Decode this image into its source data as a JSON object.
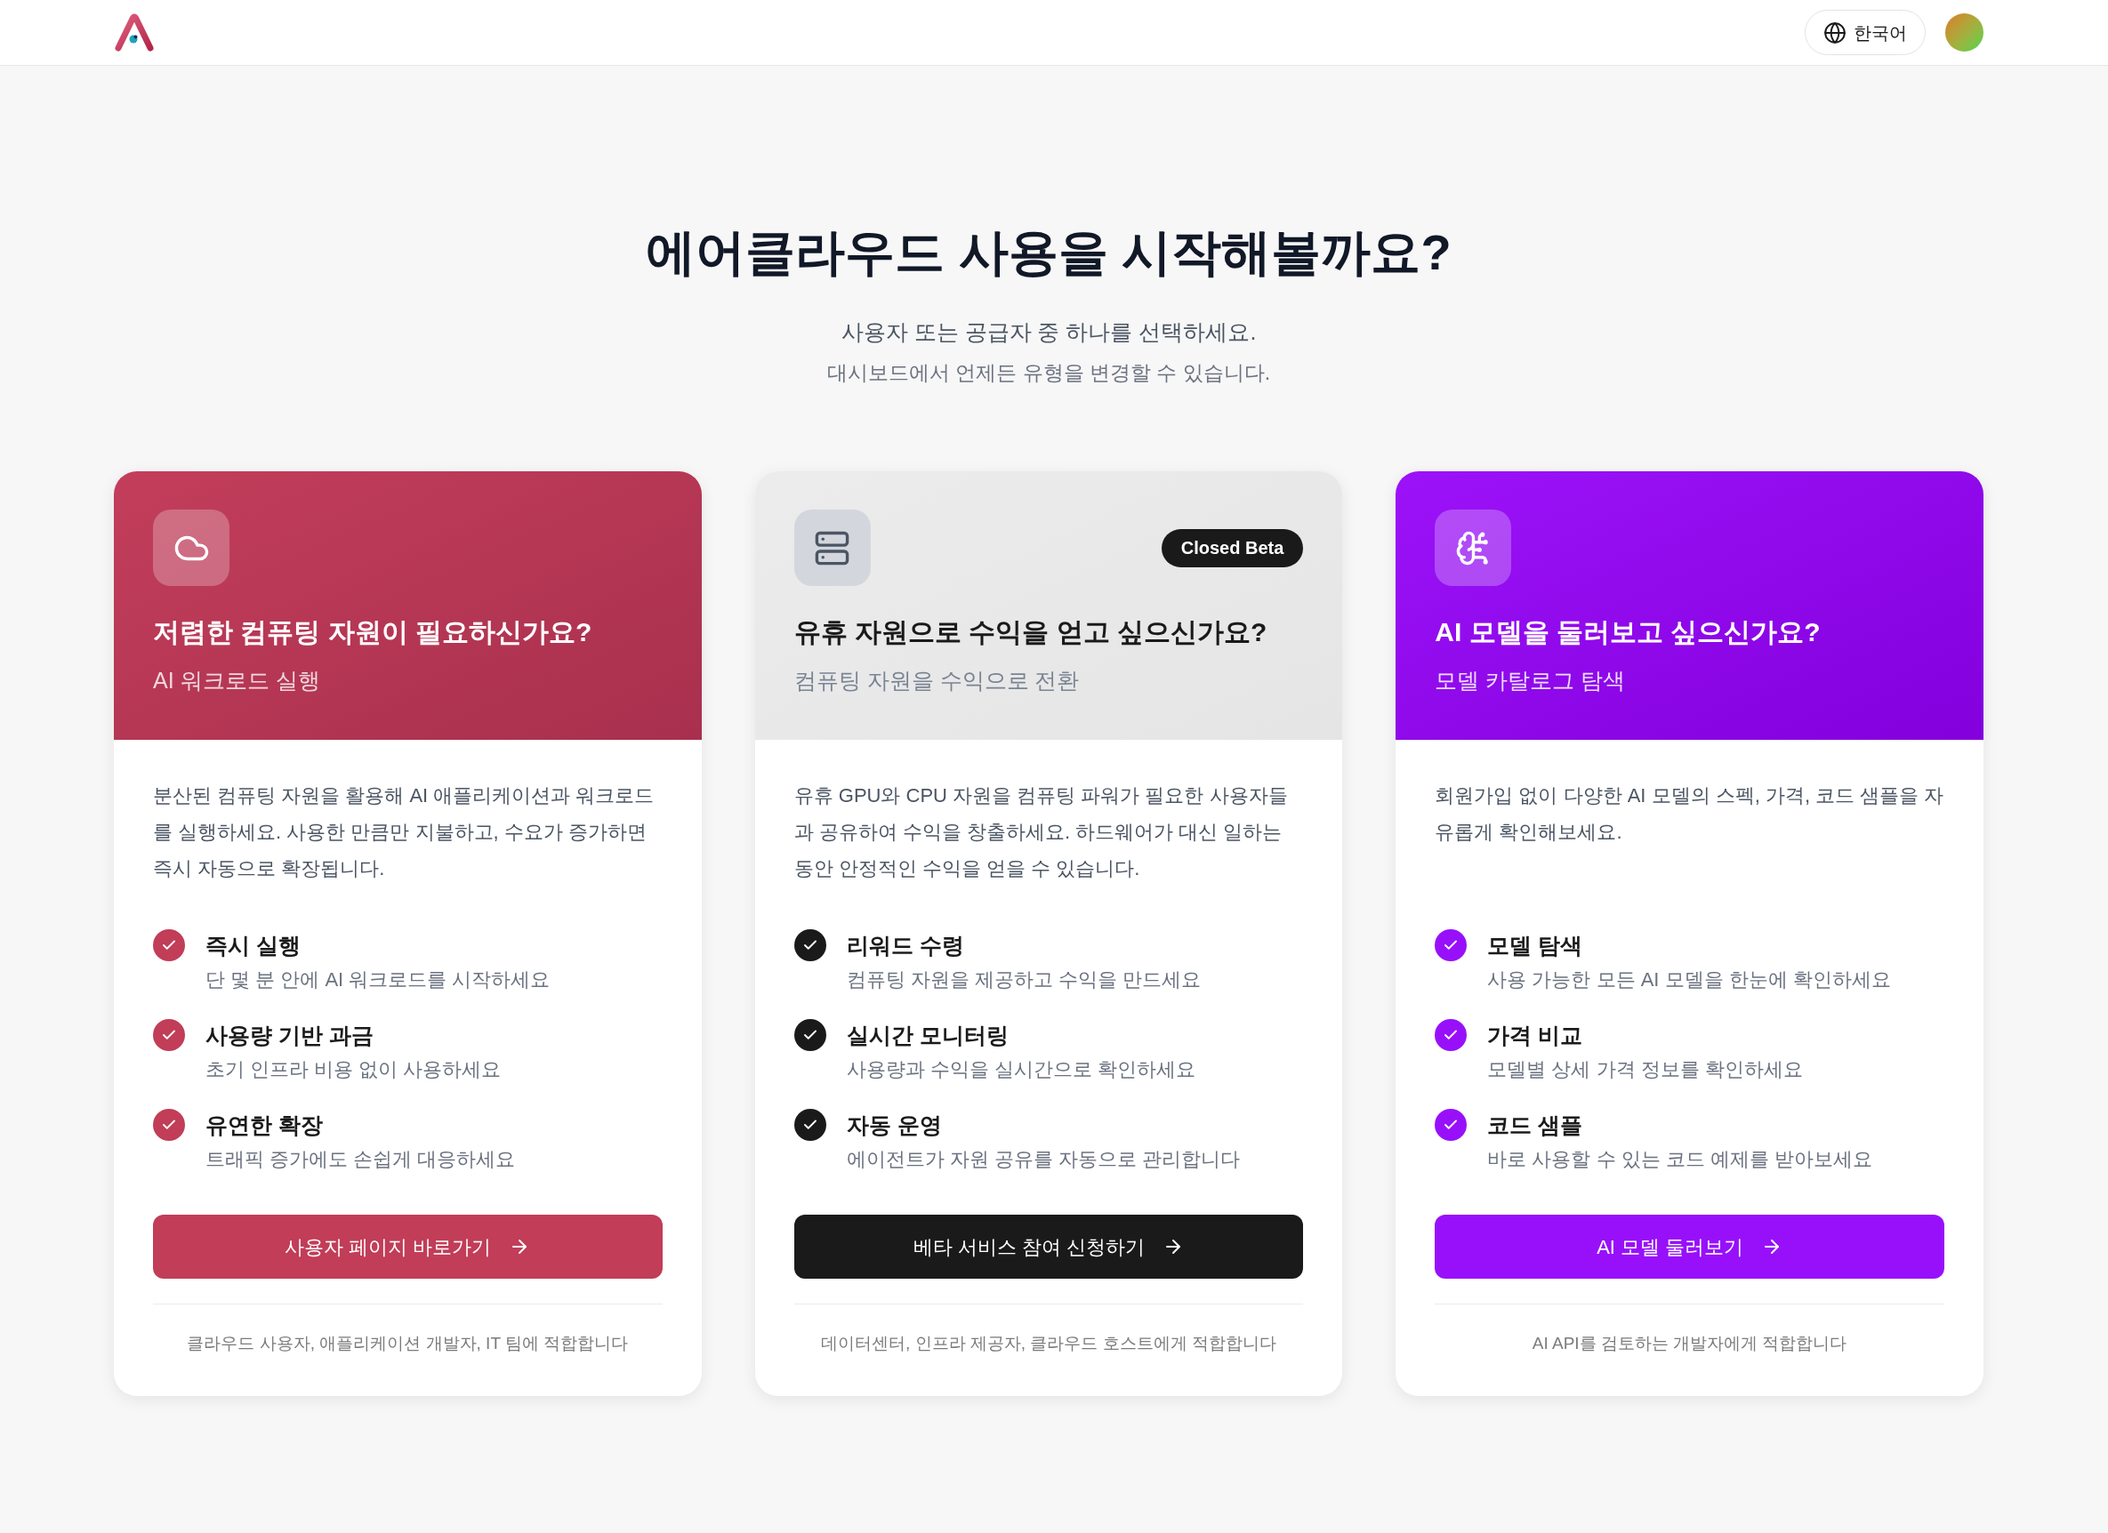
{
  "header": {
    "language": "한국어"
  },
  "hero": {
    "title": "에어클라우드 사용을 시작해볼까요?",
    "subtitle": "사용자 또는 공급자 중 하나를 선택하세요.",
    "note": "대시보드에서 언제든 유형을 변경할 수 있습니다."
  },
  "cards": [
    {
      "kind": "user",
      "title": "저렴한 컴퓨팅 자원이 필요하신가요?",
      "subtitle": "AI 워크로드 실행",
      "description": "분산된 컴퓨팅 자원을 활용해 AI 애플리케이션과 워크로드를 실행하세요. 사용한 만큼만 지불하고, 수요가 증가하면 즉시 자동으로 확장됩니다.",
      "features": [
        {
          "title": "즉시 실행",
          "text": "단 몇 분 안에 AI 워크로드를 시작하세요"
        },
        {
          "title": "사용량 기반 과금",
          "text": "초기 인프라 비용 없이 사용하세요"
        },
        {
          "title": "유연한 확장",
          "text": "트래픽 증가에도 손쉽게 대응하세요"
        }
      ],
      "button": "사용자 페이지 바로가기",
      "footer": "클라우드 사용자, 애플리케이션 개발자, IT 팀에 적합합니다"
    },
    {
      "kind": "provider",
      "badge": "Closed Beta",
      "title": "유휴 자원으로 수익을 얻고 싶으신가요?",
      "subtitle": "컴퓨팅 자원을 수익으로 전환",
      "description": "유휴 GPU와 CPU 자원을 컴퓨팅 파워가 필요한 사용자들과 공유하여 수익을 창출하세요. 하드웨어가 대신 일하는 동안 안정적인 수익을 얻을 수 있습니다.",
      "features": [
        {
          "title": "리워드 수령",
          "text": "컴퓨팅 자원을 제공하고 수익을 만드세요"
        },
        {
          "title": "실시간 모니터링",
          "text": "사용량과 수익을 실시간으로 확인하세요"
        },
        {
          "title": "자동 운영",
          "text": "에이전트가 자원 공유를 자동으로 관리합니다"
        }
      ],
      "button": "베타 서비스 참여 신청하기",
      "footer": "데이터센터, 인프라 제공자, 클라우드 호스트에게 적합합니다"
    },
    {
      "kind": "models",
      "title": "AI 모델을 둘러보고 싶으신가요?",
      "subtitle": "모델 카탈로그 탐색",
      "description": "회원가입 없이 다양한 AI 모델의 스펙, 가격, 코드 샘플을 자유롭게 확인해보세요.",
      "features": [
        {
          "title": "모델 탐색",
          "text": "사용 가능한 모든 AI 모델을 한눈에 확인하세요"
        },
        {
          "title": "가격 비교",
          "text": "모델별 상세 가격 정보를 확인하세요"
        },
        {
          "title": "코드 샘플",
          "text": "바로 사용할 수 있는 코드 예제를 받아보세요"
        }
      ],
      "button": "AI 모델 둘러보기",
      "footer": "AI API를 검토하는 개발자에게 적합합니다"
    }
  ]
}
